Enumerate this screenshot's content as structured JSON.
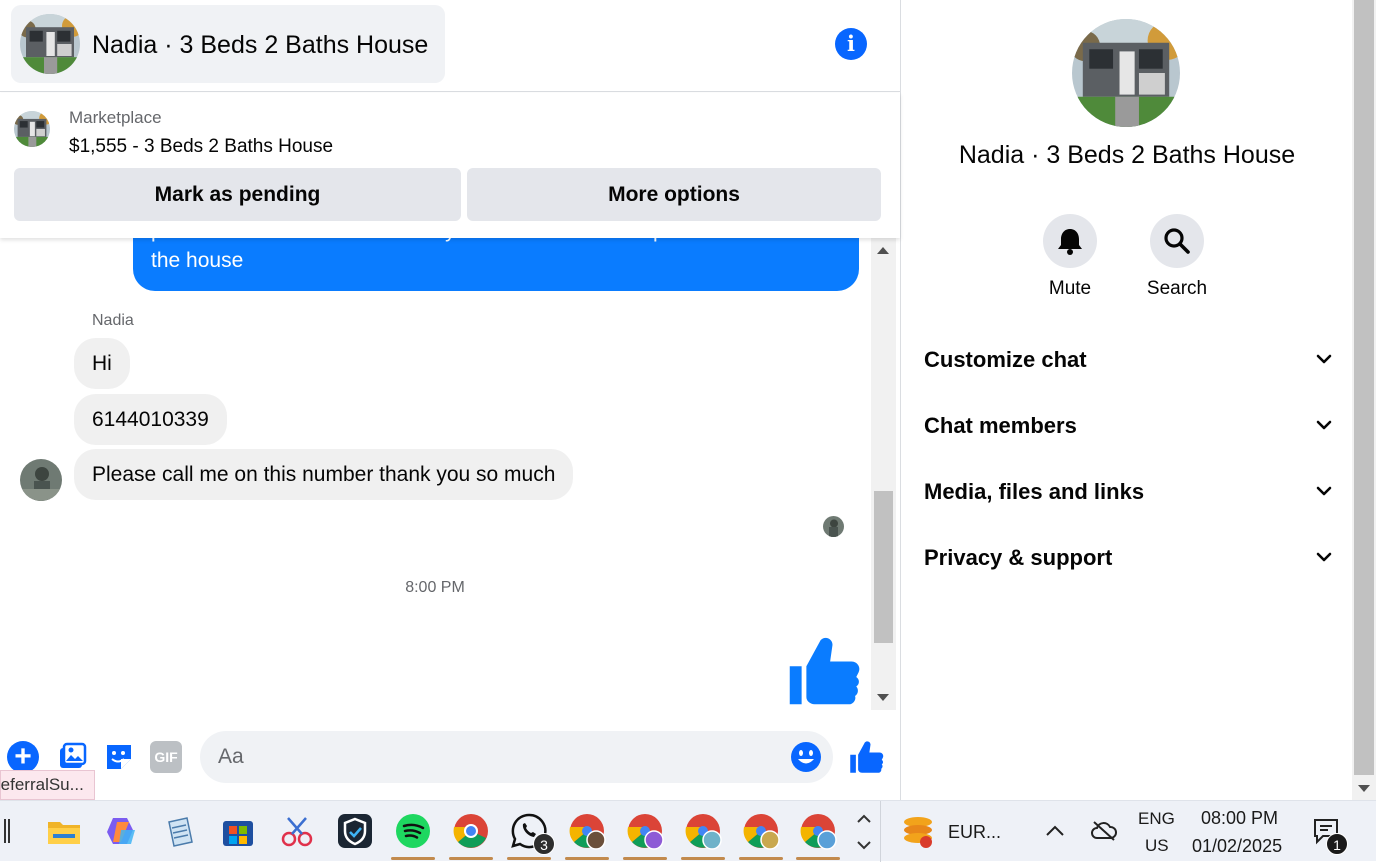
{
  "header": {
    "title": "Nadia · 3 Beds 2 Baths House",
    "info_icon": "info-icon"
  },
  "marketplace": {
    "label": "Marketplace",
    "item": "$1,555 - 3 Beds 2 Baths House",
    "mark_pending_label": "Mark as pending",
    "more_options_label": "More options"
  },
  "messages": {
    "outgoing_partial": "personal number so I can send you details and the requirements about the house",
    "sender_name": "Nadia",
    "incoming": [
      "Hi",
      "6144010339",
      "Please call me on this number thank you so much"
    ],
    "timestamp": "8:00 PM"
  },
  "composer": {
    "placeholder": "Aa",
    "icons": [
      "plus-icon",
      "photo-icon",
      "sticker-icon",
      "gif-icon",
      "emoji-icon",
      "like-icon"
    ],
    "gif_label": "GIF"
  },
  "tooltip": {
    "text": "referralSu..."
  },
  "panel": {
    "name": "Nadia · 3 Beds 2 Baths House",
    "actions": {
      "mute": "Mute",
      "search": "Search"
    },
    "sections": [
      "Customize chat",
      "Chat members",
      "Media, files and links",
      "Privacy & support"
    ]
  },
  "taskbar": {
    "whatsapp_badge": "3",
    "currency": "EUR...",
    "lang_top": "ENG",
    "lang_bottom": "US",
    "time": "08:00 PM",
    "date": "01/02/2025",
    "notification_count": "1"
  },
  "colors": {
    "messenger_blue": "#0a7cff",
    "bubble_gray": "#f0f0f0",
    "button_gray": "#e4e6eb"
  }
}
